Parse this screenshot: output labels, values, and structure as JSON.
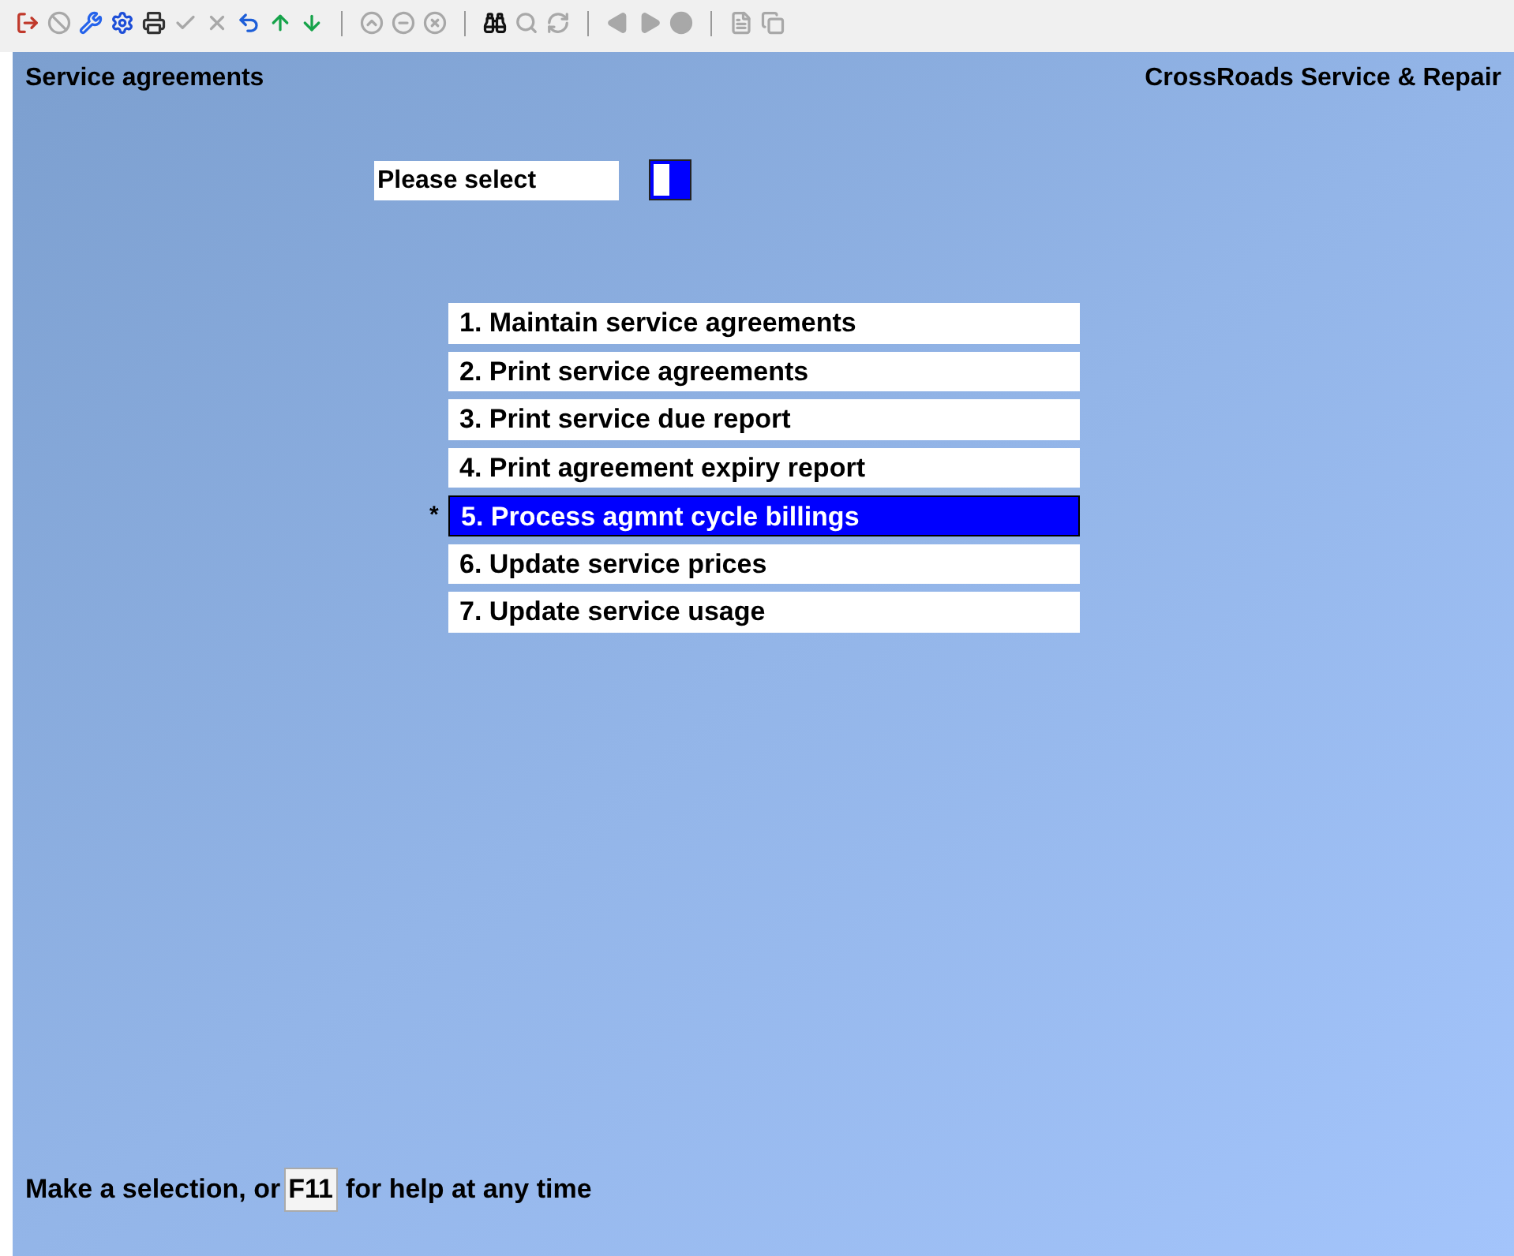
{
  "toolbar": [
    {
      "kind": "exit",
      "disabled": false
    },
    {
      "kind": "cancel",
      "disabled": true
    },
    {
      "kind": "tools",
      "disabled": false
    },
    {
      "kind": "gear",
      "disabled": false
    },
    {
      "kind": "print",
      "disabled": false
    },
    {
      "kind": "check",
      "disabled": true
    },
    {
      "kind": "delete",
      "disabled": true
    },
    {
      "kind": "undo",
      "disabled": false
    },
    {
      "kind": "up",
      "disabled": false
    },
    {
      "kind": "down",
      "disabled": false
    },
    {
      "kind": "separator"
    },
    {
      "kind": "circle-first",
      "disabled": true
    },
    {
      "kind": "circle-middle",
      "disabled": true
    },
    {
      "kind": "circle-close",
      "disabled": true
    },
    {
      "kind": "separator"
    },
    {
      "kind": "find",
      "disabled": false
    },
    {
      "kind": "zoom",
      "disabled": true
    },
    {
      "kind": "refresh",
      "disabled": true
    },
    {
      "kind": "separator"
    },
    {
      "kind": "previous",
      "disabled": true
    },
    {
      "kind": "next",
      "disabled": true
    },
    {
      "kind": "record",
      "disabled": true
    },
    {
      "kind": "separator"
    },
    {
      "kind": "document",
      "disabled": true
    },
    {
      "kind": "copy",
      "disabled": true
    }
  ],
  "header": {
    "title": "Service agreements",
    "company": "CrossRoads Service & Repair"
  },
  "prompt": {
    "label": "Please select"
  },
  "menu": [
    {
      "label": "1. Maintain service agreements",
      "selected": false
    },
    {
      "label": "2. Print service agreements",
      "selected": false
    },
    {
      "label": "3. Print service due report",
      "selected": false
    },
    {
      "label": "4. Print agreement expiry report",
      "selected": false
    },
    {
      "label": "5. Process agmnt cycle billings",
      "selected": true,
      "marker": "*"
    },
    {
      "label": "6. Update service prices",
      "selected": false
    },
    {
      "label": "7. Update service usage",
      "selected": false
    }
  ],
  "footer": {
    "before": "Make a selection, or",
    "key": "F11",
    "after": "for help at any time"
  }
}
